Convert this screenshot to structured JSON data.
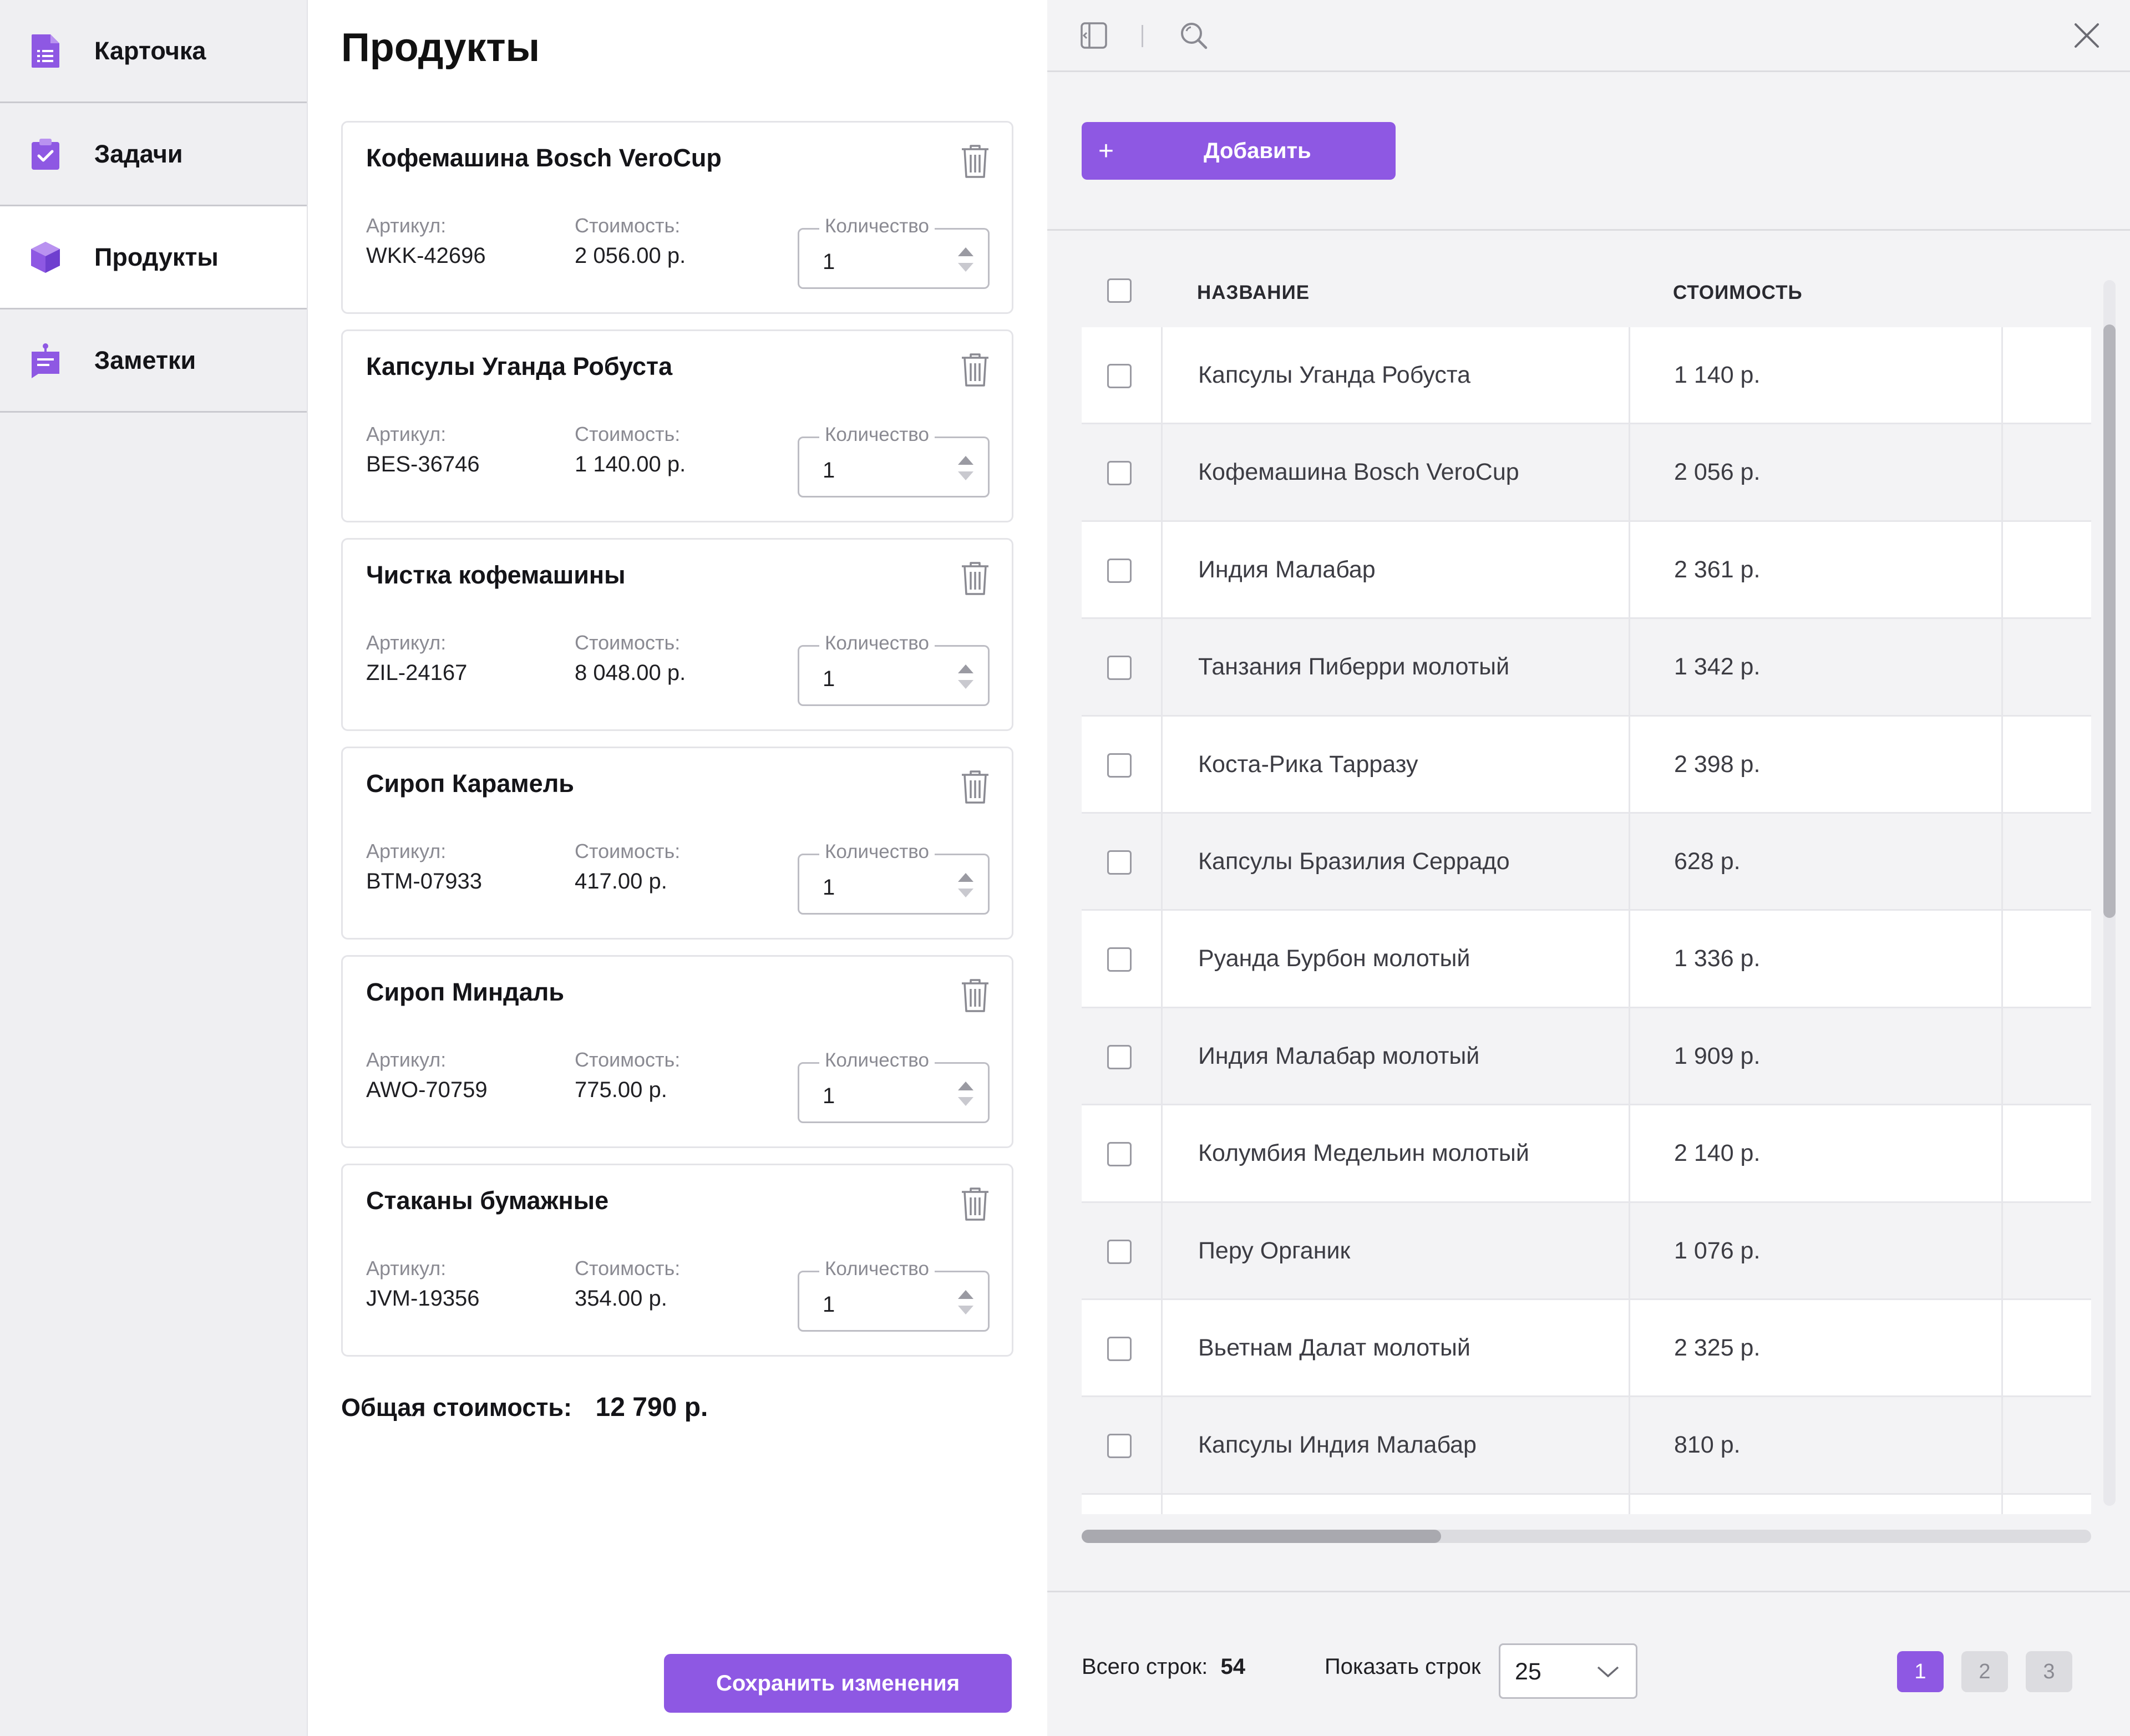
{
  "sidebar": {
    "items": [
      {
        "label": "Карточка",
        "icon": "document-list-icon",
        "active": false
      },
      {
        "label": "Задачи",
        "icon": "clipboard-check-icon",
        "active": false
      },
      {
        "label": "Продукты",
        "icon": "cube-icon",
        "active": true
      },
      {
        "label": "Заметки",
        "icon": "note-pin-icon",
        "active": false
      }
    ]
  },
  "products_panel": {
    "title": "Продукты",
    "article_label": "Артикул:",
    "cost_label": "Стоимость:",
    "qty_label": "Количество",
    "items": [
      {
        "name": "Кофемашина Bosch VeroCup",
        "sku": "WKK-42696",
        "cost": "2 056.00 р.",
        "qty": "1"
      },
      {
        "name": "Капсулы Уганда Робуста",
        "sku": "BES-36746",
        "cost": "1 140.00 р.",
        "qty": "1"
      },
      {
        "name": "Чистка кофемашины",
        "sku": "ZIL-24167",
        "cost": "8 048.00 р.",
        "qty": "1"
      },
      {
        "name": "Сироп Карамель",
        "sku": "BTM-07933",
        "cost": "417.00 р.",
        "qty": "1"
      },
      {
        "name": "Сироп Миндаль",
        "sku": "AWO-70759",
        "cost": "775.00 р.",
        "qty": "1"
      },
      {
        "name": "Стаканы бумажные",
        "sku": "JVM-19356",
        "cost": "354.00 р.",
        "qty": "1"
      }
    ],
    "total_label": "Общая стоимость:",
    "total_value": "12 790 р.",
    "save_label": "Сохранить изменения"
  },
  "drawer": {
    "toolbar": {
      "collapse_icon": "panel-collapse-icon",
      "search_icon": "search-icon",
      "close_icon": "close-icon"
    },
    "add_plus": "+",
    "add_label": "Добавить",
    "columns": {
      "name": "НАЗВАНИЕ",
      "cost": "СТОИМОСТЬ"
    },
    "rows": [
      {
        "name": "Капсулы Уганда Робуста",
        "cost": "1 140 р."
      },
      {
        "name": "Кофемашина Bosch VeroCup",
        "cost": "2 056 р."
      },
      {
        "name": "Индия Малабар",
        "cost": "2 361 р."
      },
      {
        "name": "Танзания Пиберри молотый",
        "cost": "1 342 р."
      },
      {
        "name": "Коста-Рика Тарразу",
        "cost": "2 398 р."
      },
      {
        "name": "Капсулы Бразилия Серрадо",
        "cost": "628 р."
      },
      {
        "name": "Руанда Бурбон молотый",
        "cost": "1 336 р."
      },
      {
        "name": "Индия Малабар молотый",
        "cost": "1 909 р."
      },
      {
        "name": "Колумбия Медельин молотый",
        "cost": "2 140 р."
      },
      {
        "name": "Перу Органик",
        "cost": "1 076 р."
      },
      {
        "name": "Вьетнам Далат молотый",
        "cost": "2 325 р."
      },
      {
        "name": "Капсулы Индия Малабар",
        "cost": "810 р."
      }
    ],
    "footer": {
      "total_rows_label": "Всего строк:",
      "total_rows_value": "54",
      "show_rows_label": "Показать строк",
      "rows_per_page": "25",
      "pages": [
        "1",
        "2",
        "3"
      ],
      "current_page": "1"
    }
  },
  "colors": {
    "accent": "#8e58e3",
    "sidebar_bg": "#efeff2",
    "drawer_bg": "#f3f3f5"
  }
}
